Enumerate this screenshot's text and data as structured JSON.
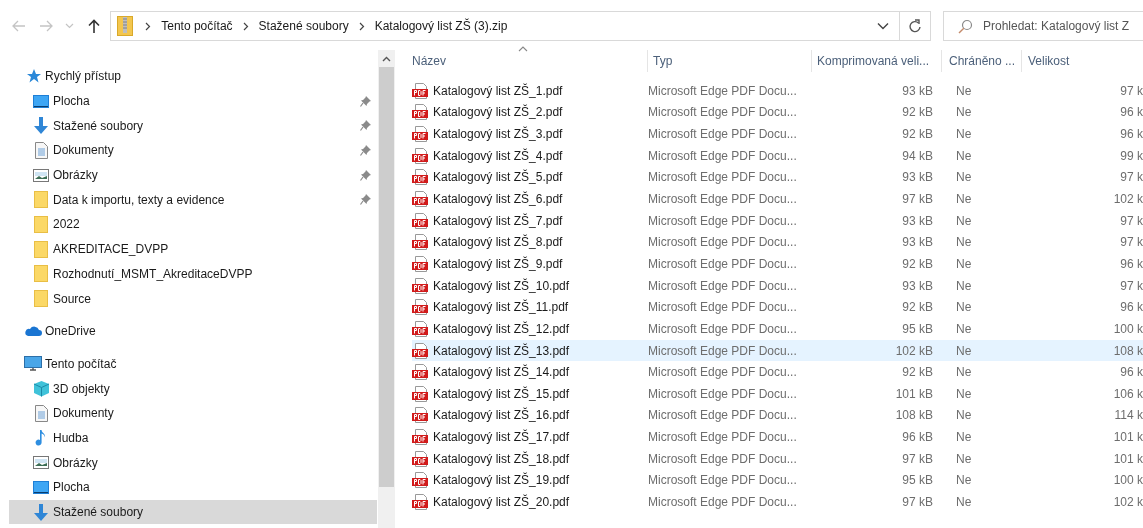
{
  "navigation": {
    "back": {
      "disabled": true
    },
    "forward": {
      "disabled": true
    },
    "up": {
      "disabled": false
    }
  },
  "address_bar": {
    "crumbs": [
      "Tento počítač",
      "Stažené soubory",
      "Katalogový list ZŠ (3).zip"
    ]
  },
  "search": {
    "placeholder": "Prohledat: Katalogový list Z"
  },
  "sidebar": {
    "groups": [
      {
        "label": "Rychlý přístup",
        "kind": "star",
        "children": [
          {
            "label": "Plocha",
            "kind": "desktop",
            "pinned": true,
            "selected": false
          },
          {
            "label": "Stažené soubory",
            "kind": "download",
            "pinned": true,
            "selected": false
          },
          {
            "label": "Dokumenty",
            "kind": "document",
            "pinned": true,
            "selected": false
          },
          {
            "label": "Obrázky",
            "kind": "pictures",
            "pinned": true,
            "selected": false
          },
          {
            "label": "Data k importu, texty a evidence",
            "kind": "folder",
            "pinned": true,
            "selected": false
          },
          {
            "label": "2022",
            "kind": "folder",
            "pinned": false,
            "selected": false
          },
          {
            "label": "AKREDITACE_DVPP",
            "kind": "folder",
            "pinned": false,
            "selected": false
          },
          {
            "label": "Rozhodnutí_MSMT_AkreditaceDVPP",
            "kind": "folder",
            "pinned": false,
            "selected": false
          },
          {
            "label": "Source",
            "kind": "folder",
            "pinned": false,
            "selected": false
          }
        ]
      },
      {
        "label": "OneDrive",
        "kind": "cloud"
      },
      {
        "label": "Tento počítač",
        "kind": "pc",
        "children": [
          {
            "label": "3D objekty",
            "kind": "cube",
            "pinned": false,
            "selected": false
          },
          {
            "label": "Dokumenty",
            "kind": "document",
            "pinned": false,
            "selected": false
          },
          {
            "label": "Hudba",
            "kind": "music",
            "pinned": false,
            "selected": false
          },
          {
            "label": "Obrázky",
            "kind": "pictures",
            "pinned": false,
            "selected": false
          },
          {
            "label": "Plocha",
            "kind": "desktop",
            "pinned": false,
            "selected": false
          },
          {
            "label": "Stažené soubory",
            "kind": "download",
            "pinned": false,
            "selected": true
          }
        ]
      }
    ]
  },
  "table": {
    "columns": [
      "Název",
      "Typ",
      "Komprimovaná veli...",
      "Chráněno ...",
      "Velikost"
    ],
    "rows": [
      {
        "name": "Katalogový list ZŠ_1.pdf",
        "type": "Microsoft Edge PDF Docu...",
        "compressed": "93 kB",
        "protected": "Ne",
        "size": "97 k",
        "hovered": false
      },
      {
        "name": "Katalogový list ZŠ_2.pdf",
        "type": "Microsoft Edge PDF Docu...",
        "compressed": "92 kB",
        "protected": "Ne",
        "size": "96 k",
        "hovered": false
      },
      {
        "name": "Katalogový list ZŠ_3.pdf",
        "type": "Microsoft Edge PDF Docu...",
        "compressed": "92 kB",
        "protected": "Ne",
        "size": "96 k",
        "hovered": false
      },
      {
        "name": "Katalogový list ZŠ_4.pdf",
        "type": "Microsoft Edge PDF Docu...",
        "compressed": "94 kB",
        "protected": "Ne",
        "size": "99 k",
        "hovered": false
      },
      {
        "name": "Katalogový list ZŠ_5.pdf",
        "type": "Microsoft Edge PDF Docu...",
        "compressed": "93 kB",
        "protected": "Ne",
        "size": "97 k",
        "hovered": false
      },
      {
        "name": "Katalogový list ZŠ_6.pdf",
        "type": "Microsoft Edge PDF Docu...",
        "compressed": "97 kB",
        "protected": "Ne",
        "size": "102 k",
        "hovered": false
      },
      {
        "name": "Katalogový list ZŠ_7.pdf",
        "type": "Microsoft Edge PDF Docu...",
        "compressed": "93 kB",
        "protected": "Ne",
        "size": "97 k",
        "hovered": false
      },
      {
        "name": "Katalogový list ZŠ_8.pdf",
        "type": "Microsoft Edge PDF Docu...",
        "compressed": "93 kB",
        "protected": "Ne",
        "size": "97 k",
        "hovered": false
      },
      {
        "name": "Katalogový list ZŠ_9.pdf",
        "type": "Microsoft Edge PDF Docu...",
        "compressed": "92 kB",
        "protected": "Ne",
        "size": "96 k",
        "hovered": false
      },
      {
        "name": "Katalogový list ZŠ_10.pdf",
        "type": "Microsoft Edge PDF Docu...",
        "compressed": "93 kB",
        "protected": "Ne",
        "size": "97 k",
        "hovered": false
      },
      {
        "name": "Katalogový list ZŠ_11.pdf",
        "type": "Microsoft Edge PDF Docu...",
        "compressed": "92 kB",
        "protected": "Ne",
        "size": "96 k",
        "hovered": false
      },
      {
        "name": "Katalogový list ZŠ_12.pdf",
        "type": "Microsoft Edge PDF Docu...",
        "compressed": "95 kB",
        "protected": "Ne",
        "size": "100 k",
        "hovered": false
      },
      {
        "name": "Katalogový list ZŠ_13.pdf",
        "type": "Microsoft Edge PDF Docu...",
        "compressed": "102 kB",
        "protected": "Ne",
        "size": "108 k",
        "hovered": true
      },
      {
        "name": "Katalogový list ZŠ_14.pdf",
        "type": "Microsoft Edge PDF Docu...",
        "compressed": "92 kB",
        "protected": "Ne",
        "size": "96 k",
        "hovered": false
      },
      {
        "name": "Katalogový list ZŠ_15.pdf",
        "type": "Microsoft Edge PDF Docu...",
        "compressed": "101 kB",
        "protected": "Ne",
        "size": "106 k",
        "hovered": false
      },
      {
        "name": "Katalogový list ZŠ_16.pdf",
        "type": "Microsoft Edge PDF Docu...",
        "compressed": "108 kB",
        "protected": "Ne",
        "size": "114 k",
        "hovered": false
      },
      {
        "name": "Katalogový list ZŠ_17.pdf",
        "type": "Microsoft Edge PDF Docu...",
        "compressed": "96 kB",
        "protected": "Ne",
        "size": "101 k",
        "hovered": false
      },
      {
        "name": "Katalogový list ZŠ_18.pdf",
        "type": "Microsoft Edge PDF Docu...",
        "compressed": "97 kB",
        "protected": "Ne",
        "size": "101 k",
        "hovered": false
      },
      {
        "name": "Katalogový list ZŠ_19.pdf",
        "type": "Microsoft Edge PDF Docu...",
        "compressed": "95 kB",
        "protected": "Ne",
        "size": "100 k",
        "hovered": false
      },
      {
        "name": "Katalogový list ZŠ_20.pdf",
        "type": "Microsoft Edge PDF Docu...",
        "compressed": "97 kB",
        "protected": "Ne",
        "size": "102 k",
        "hovered": false
      }
    ]
  }
}
